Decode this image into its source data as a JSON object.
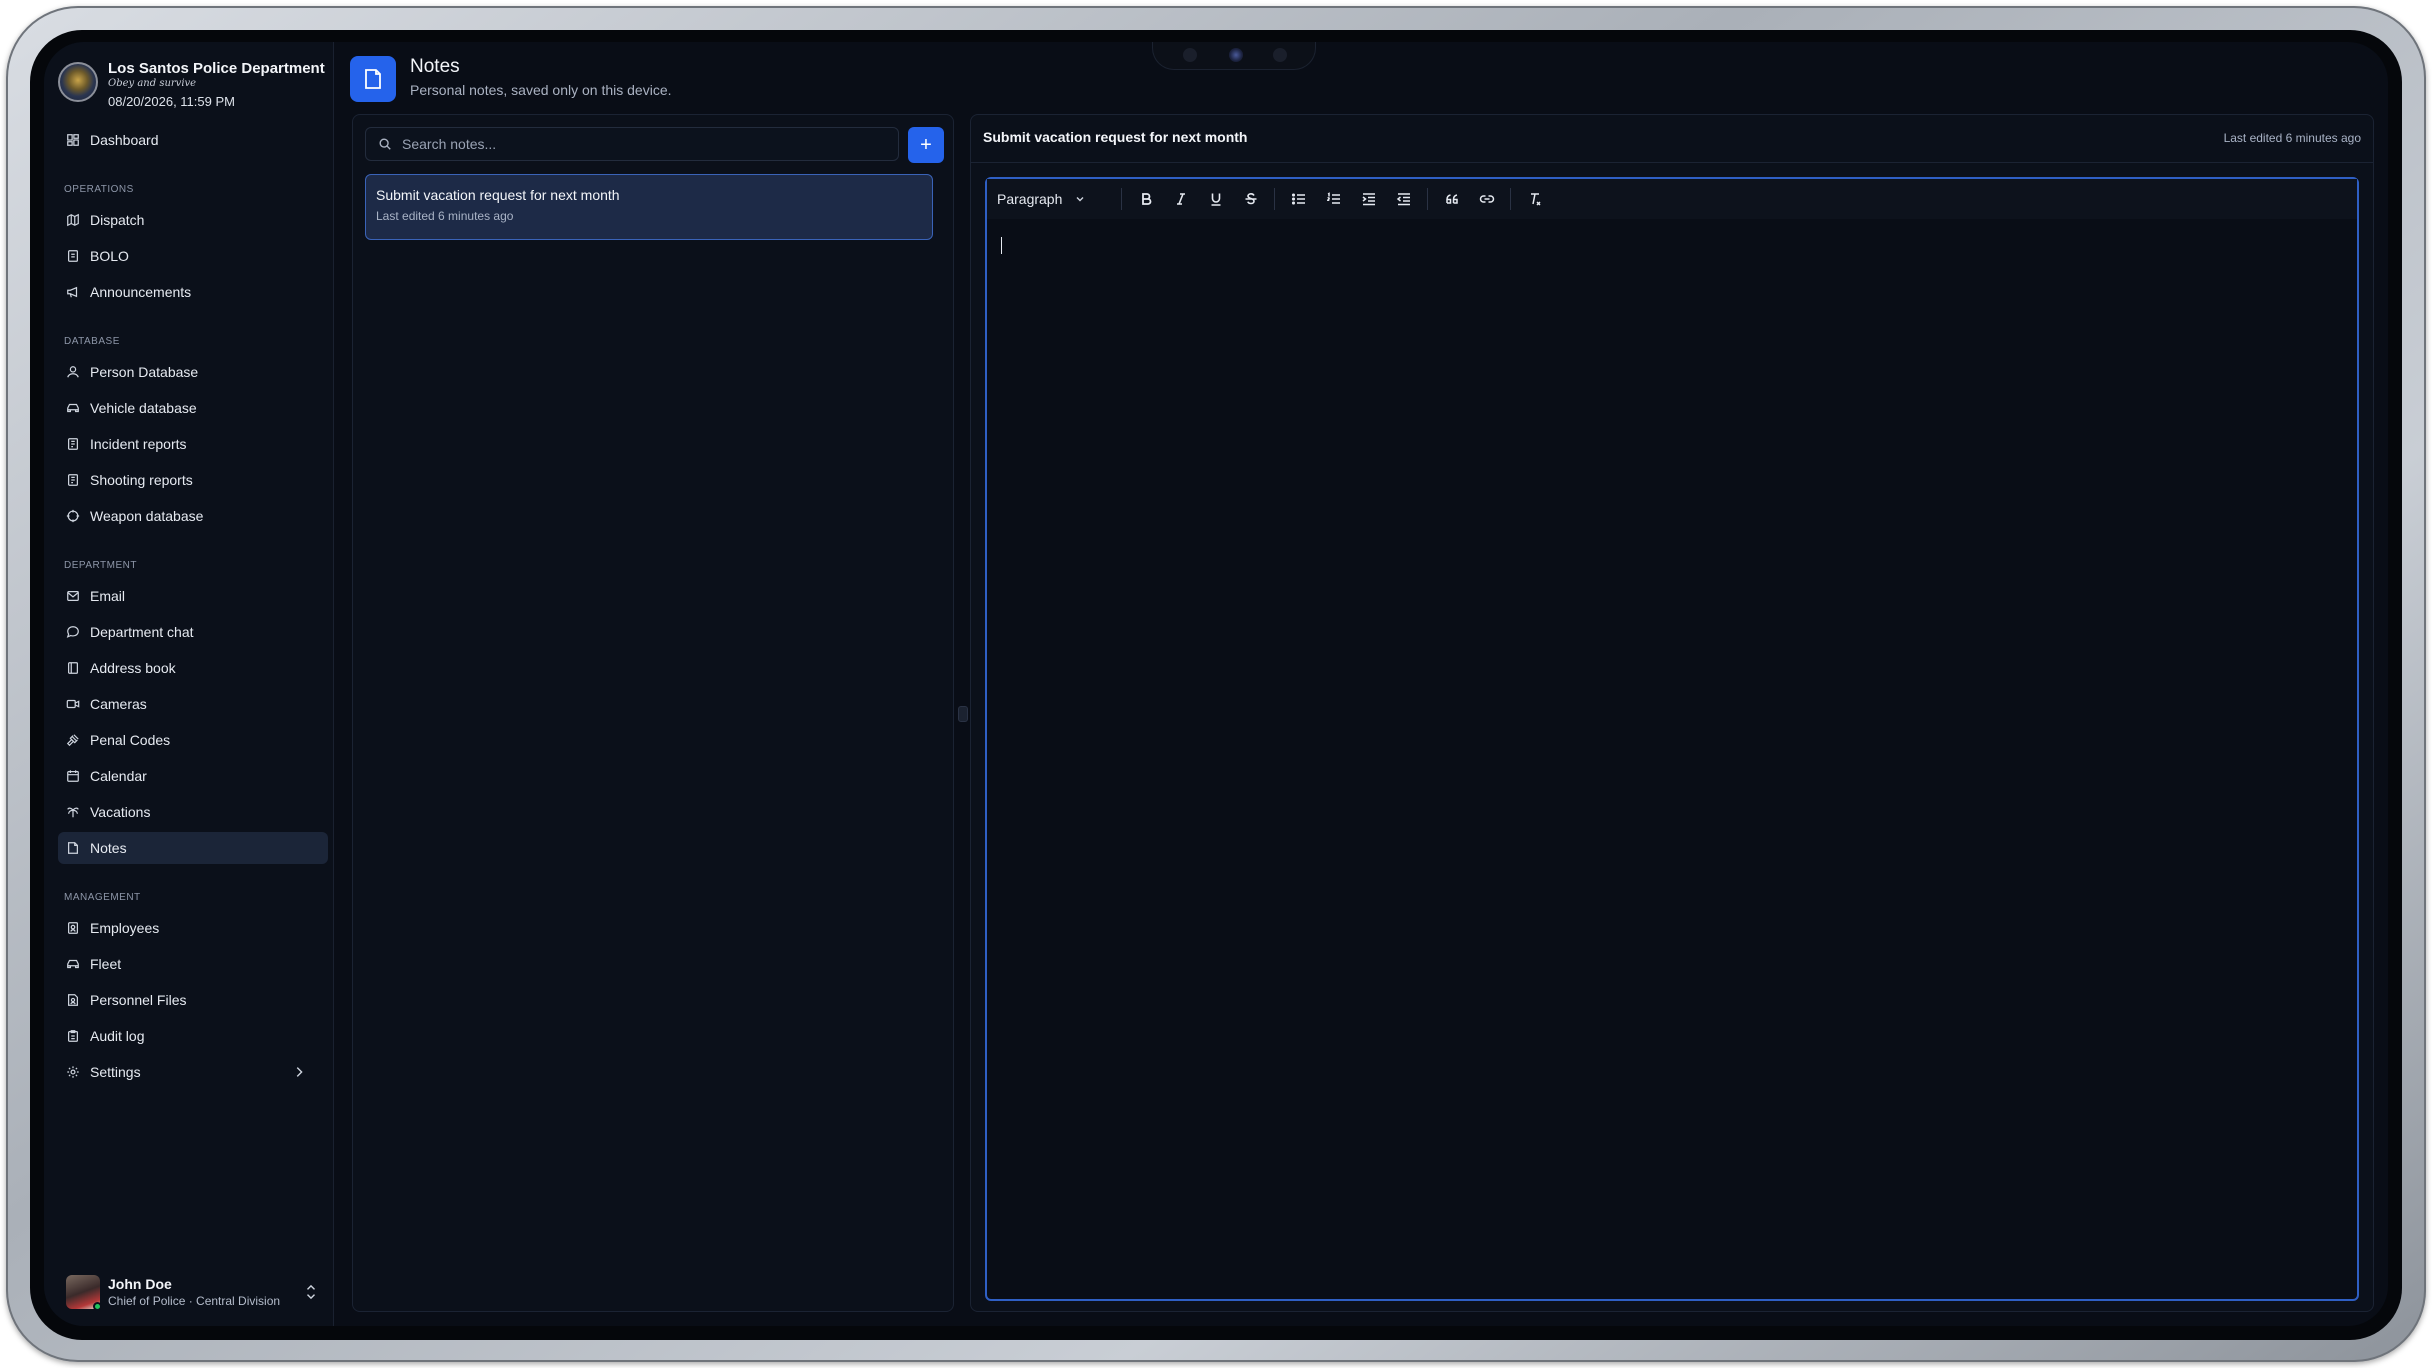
{
  "app": {
    "org_name": "Los Santos Police Department",
    "motto": "Obey and survive",
    "datetime": "08/20/2026, 11:59 PM"
  },
  "sidebar": {
    "dashboard": "Dashboard",
    "sections": {
      "operations": "OPERATIONS",
      "database": "DATABASE",
      "department": "DEPARTMENT",
      "management": "MANAGEMENT"
    },
    "items": {
      "dispatch": "Dispatch",
      "bolo": "BOLO",
      "announcements": "Announcements",
      "person_database": "Person Database",
      "vehicle_database": "Vehicle database",
      "incident_reports": "Incident reports",
      "shooting_reports": "Shooting reports",
      "weapon_database": "Weapon database",
      "email": "Email",
      "department_chat": "Department chat",
      "address_book": "Address book",
      "cameras": "Cameras",
      "penal_codes": "Penal Codes",
      "calendar": "Calendar",
      "vacations": "Vacations",
      "notes": "Notes",
      "employees": "Employees",
      "fleet": "Fleet",
      "personnel_files": "Personnel Files",
      "audit_log": "Audit log",
      "settings": "Settings"
    },
    "active_item": "Notes"
  },
  "user": {
    "name": "John Doe",
    "role": "Chief of Police · Central Division"
  },
  "header": {
    "title": "Notes",
    "subtitle": "Personal notes, saved only on this device."
  },
  "notes_list": {
    "search_placeholder": "Search notes...",
    "add_label": "+",
    "items": [
      {
        "title": "Submit vacation request for next month",
        "meta": "Last edited 6 minutes ago"
      }
    ]
  },
  "editor": {
    "title": "Submit vacation request for next month",
    "last_edited": "Last edited 6 minutes ago",
    "block_type": "Paragraph",
    "content": ""
  },
  "colors": {
    "accent": "#2563eb",
    "background": "#090d16",
    "sidebar": "#0b101a",
    "active_item": "#1b2538",
    "selected_card": "#1d2a47"
  },
  "icons": {
    "toolbar": [
      "bold-icon",
      "italic-icon",
      "underline-icon",
      "strikethrough-icon",
      "bullet-list-icon",
      "numbered-list-icon",
      "indent-icon",
      "outdent-icon",
      "quote-icon",
      "link-icon",
      "clear-format-icon"
    ]
  }
}
